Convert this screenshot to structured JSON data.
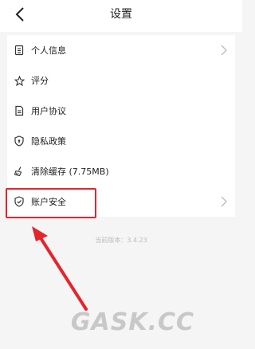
{
  "header": {
    "title": "设置"
  },
  "items": [
    {
      "label": "个人信息",
      "icon": "clipboard-icon",
      "chevron": true
    },
    {
      "label": "评分",
      "icon": "star-icon",
      "chevron": false
    },
    {
      "label": "用户协议",
      "icon": "document-icon",
      "chevron": false
    },
    {
      "label": "隐私政策",
      "icon": "shield-lock-icon",
      "chevron": false
    },
    {
      "label": "清除缓存 (7.75MB)",
      "icon": "broom-icon",
      "chevron": false
    },
    {
      "label": "账户安全",
      "icon": "shield-check-icon",
      "chevron": true
    }
  ],
  "version": "当前版本：3.4.23",
  "watermark": "GASK.CC",
  "colors": {
    "highlight": "#e5242d"
  }
}
